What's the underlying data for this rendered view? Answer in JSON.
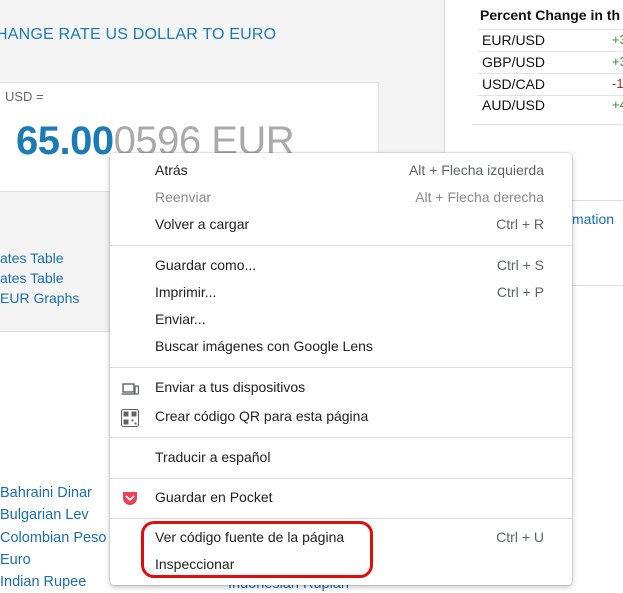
{
  "page": {
    "rate_title": "HANGE RATE US DOLLAR TO EURO",
    "usd_label": "USD =",
    "amount_main": "65.00",
    "amount_faded": "0596 EUR",
    "left_links": [
      "ates Table",
      "ates Table",
      "EUR Graphs"
    ],
    "percent_change": {
      "title": "Percent Change in th",
      "rows": [
        {
          "pair": "EUR/USD",
          "value": "+3",
          "color": "#2e8b3a"
        },
        {
          "pair": "GBP/USD",
          "value": "+3",
          "color": "#2e8b3a"
        },
        {
          "pair": "USD/CAD",
          "value": "-1",
          "color": "#c7221f"
        },
        {
          "pair": "AUD/USD",
          "value": "+4",
          "color": "#2e8b3a"
        }
      ]
    },
    "right_link": "mation",
    "currency_list": [
      "Bahraini Dinar",
      "Bulgarian Lev",
      "Colombian Peso",
      "Euro",
      "Indian Rupee"
    ],
    "partial_bottom": "Indonesian Rupiah"
  },
  "context_menu": {
    "items": [
      {
        "label": "Atrás",
        "shortcut": "Alt + Flecha izquierda"
      },
      {
        "label": "Reenviar",
        "shortcut": "Alt + Flecha derecha",
        "disabled": true
      },
      {
        "label": "Volver a cargar",
        "shortcut": "Ctrl + R"
      },
      {
        "label": "Guardar como...",
        "shortcut": "Ctrl + S"
      },
      {
        "label": "Imprimir...",
        "shortcut": "Ctrl + P"
      },
      {
        "label": "Enviar..."
      },
      {
        "label": "Buscar imágenes con Google Lens"
      },
      {
        "label": "Enviar a tus dispositivos",
        "icon": "devices-icon"
      },
      {
        "label": "Crear código QR para esta página",
        "icon": "qr-code-icon"
      },
      {
        "label": "Traducir a español"
      },
      {
        "label": "Guardar en Pocket",
        "icon": "pocket-icon"
      },
      {
        "label": "Ver código fuente de la página",
        "shortcut": "Ctrl + U"
      },
      {
        "label": "Inspeccionar"
      }
    ]
  },
  "colors": {
    "accent_blue": "#1a7bb5",
    "highlight_red": "#e00d0d",
    "pocket_red": "#ef4056"
  }
}
